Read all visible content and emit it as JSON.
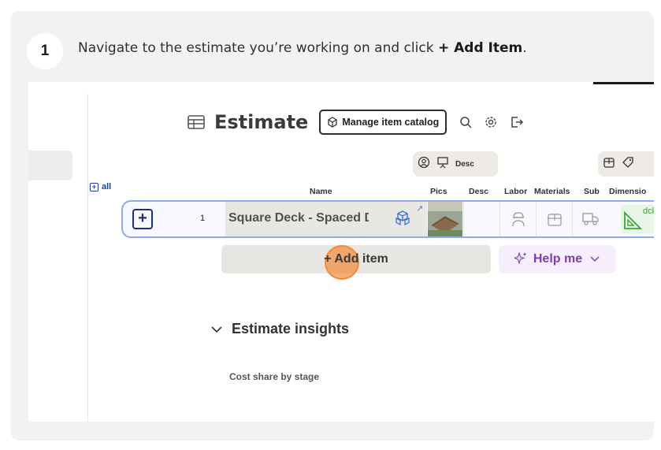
{
  "step": {
    "number": "1",
    "text_before": "Navigate to the estimate you’re working on and click ",
    "text_bold": "+ Add Item",
    "text_after": "."
  },
  "estimate": {
    "title": "Estimate",
    "manage_catalog_label": "Manage item catalog"
  },
  "column_toggles": {
    "desc_label": "Desc"
  },
  "table": {
    "all_label": "all",
    "headers": {
      "name": "Name",
      "pics": "Pics",
      "desc": "Desc",
      "labor": "Labor",
      "materials": "Materials",
      "sub": "Sub",
      "dimensions": "Dimensio"
    },
    "rows": [
      {
        "number": "1",
        "name": "Square Deck - Spaced Deck",
        "dimension_tag": "dck"
      }
    ]
  },
  "actions": {
    "add_item_label": "+ Add item",
    "help_me_label": "Help me"
  },
  "insights": {
    "title": "Estimate insights",
    "cost_share_label": "Cost share by stage"
  },
  "colors": {
    "accent_blue": "#1a3fb0",
    "row_border": "#8fa8ee",
    "click_marker": "#f08a3c",
    "help_purple": "#7a3fb3"
  }
}
